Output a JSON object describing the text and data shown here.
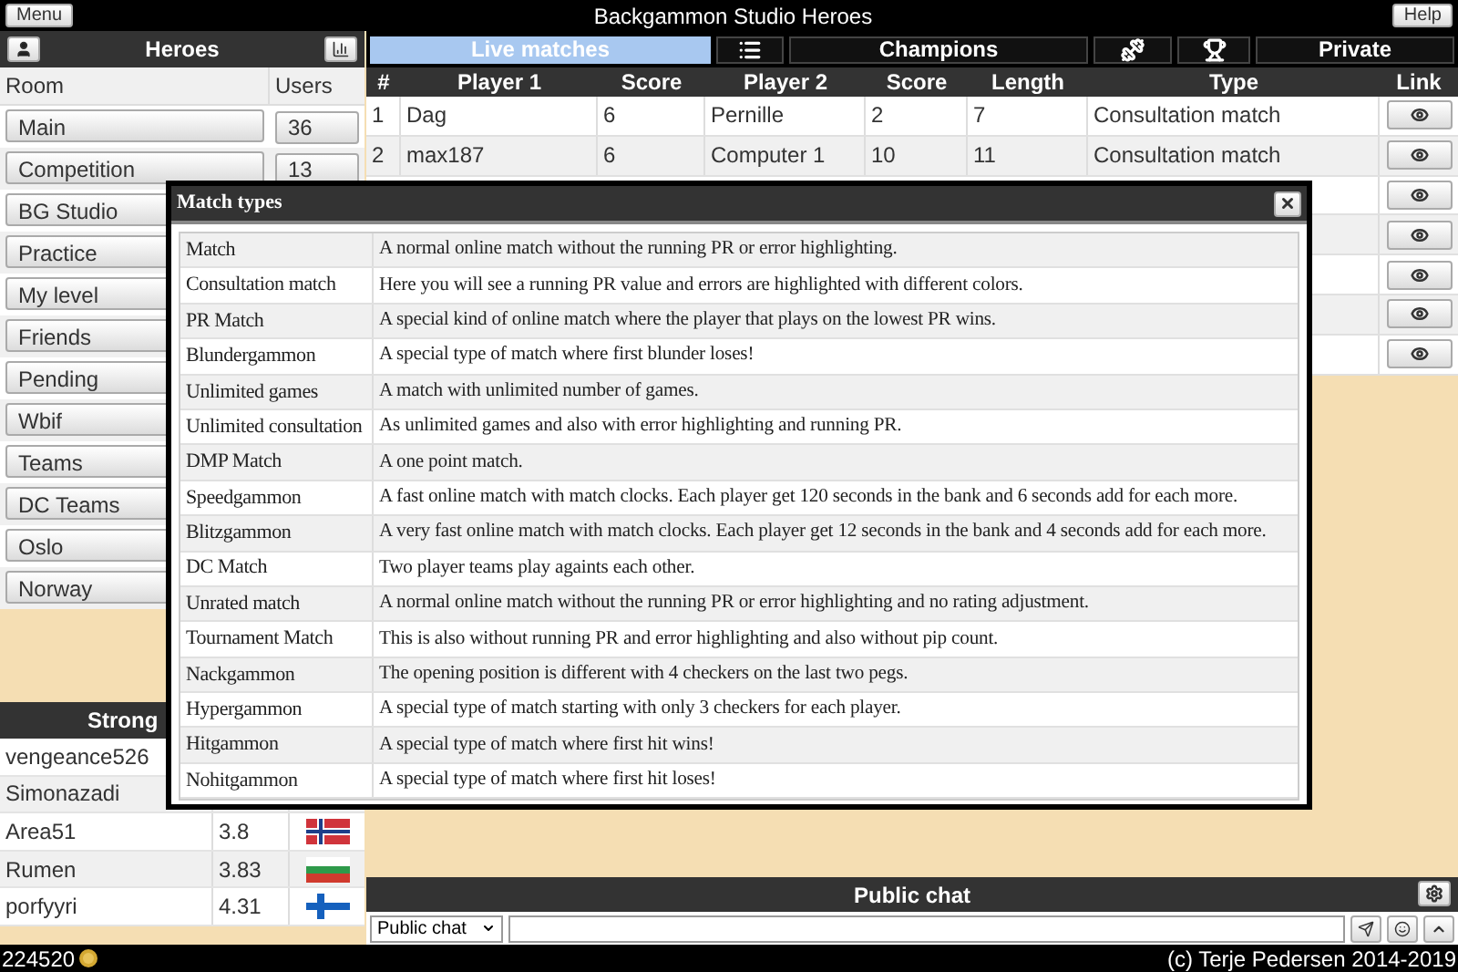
{
  "app": {
    "menu_button": "Menu",
    "title": "Backgammon Studio Heroes",
    "help_button": "Help"
  },
  "heroes_panel": {
    "title": "Heroes",
    "columns": [
      "Room",
      "Users"
    ],
    "rooms": [
      {
        "name": "Main",
        "users": "36"
      },
      {
        "name": "Competition",
        "users": "13"
      },
      {
        "name": "BG Studio"
      },
      {
        "name": "Practice"
      },
      {
        "name": "My level"
      },
      {
        "name": "Friends"
      },
      {
        "name": "Pending"
      },
      {
        "name": "Wbif"
      },
      {
        "name": "Teams"
      },
      {
        "name": "DC Teams"
      },
      {
        "name": "Oslo"
      },
      {
        "name": "Norway"
      }
    ]
  },
  "players_panel": {
    "title": "Strong",
    "rows": [
      {
        "name": "vengeance526"
      },
      {
        "name": "Simonazadi"
      },
      {
        "name": "Area51",
        "value": "3.8",
        "kind": "no"
      },
      {
        "name": "Rumen",
        "value": "3.83",
        "kind": "bg"
      },
      {
        "name": "porfyyri",
        "value": "4.31",
        "kind": "fi"
      }
    ]
  },
  "tabs": [
    {
      "kind": "text",
      "label": "Live matches",
      "selected": true
    },
    {
      "kind": "list",
      "selected": false
    },
    {
      "kind": "text",
      "label": "Champions",
      "selected": false
    },
    {
      "kind": "dumbbell",
      "selected": false
    },
    {
      "kind": "trophy",
      "selected": false
    },
    {
      "kind": "text",
      "label": "Private",
      "selected": false
    }
  ],
  "matches": {
    "columns": [
      "#",
      "Player 1",
      "Score",
      "Player 2",
      "Score",
      "Length",
      "Type",
      "Link"
    ],
    "rows": [
      {
        "kind": "full",
        "cells": [
          "1",
          "Dag",
          "6",
          "Pernille",
          "2",
          "7",
          "Consultation match"
        ]
      },
      {
        "kind": "full",
        "cells": [
          "2",
          "max187",
          "6",
          "Computer 1",
          "10",
          "11",
          "Consultation match"
        ]
      },
      {
        "kind": "covered"
      },
      {
        "kind": "covered"
      },
      {
        "kind": "covered"
      },
      {
        "kind": "covered"
      },
      {
        "kind": "covered"
      }
    ]
  },
  "chat": {
    "title": "Public chat",
    "channel": "Public chat"
  },
  "status_bar": {
    "credits": "224520",
    "copyright": "(c) Terje Pedersen 2014-2019"
  },
  "dialog": {
    "title": "Match types",
    "rows": [
      {
        "name": "Match",
        "description": "A normal online match without the running PR or error highlighting."
      },
      {
        "name": "Consultation match",
        "description": "Here you will see a running PR value and errors are highlighted with different colors."
      },
      {
        "name": "PR Match",
        "description": "A special kind of online match where the player that plays on the lowest PR wins."
      },
      {
        "name": "Blundergammon",
        "description": "A special type of match where first blunder loses!"
      },
      {
        "name": "Unlimited games",
        "description": "A match with unlimited number of games."
      },
      {
        "name": "Unlimited consultation",
        "description": "As unlimited games and also with error highlighting and running PR."
      },
      {
        "name": "DMP Match",
        "description": "A one point match."
      },
      {
        "name": "Speedgammon",
        "description": "A fast online match with match clocks. Each player get 120 seconds in the bank and 6 seconds add for each more."
      },
      {
        "name": "Blitzgammon",
        "description": "A very fast online match with match clocks. Each player get 12 seconds in the bank and 4 seconds add for each more."
      },
      {
        "name": "DC Match",
        "description": "Two player teams play againts each other."
      },
      {
        "name": "Unrated match",
        "description": "A normal online match without the running PR or error highlighting and no rating adjustment."
      },
      {
        "name": "Tournament Match",
        "description": "This is also without running PR and error highlighting and also without pip count."
      },
      {
        "name": "Nackgammon",
        "description": "The opening position is different with 4 checkers on the last two pegs."
      },
      {
        "name": "Hypergammon",
        "description": "A special type of match starting with only 3 checkers for each player."
      },
      {
        "name": "Hitgammon",
        "description": "A special type of match where first hit wins!"
      },
      {
        "name": "Nohitgammon",
        "description": "A special type of match where first hit loses!"
      }
    ]
  }
}
